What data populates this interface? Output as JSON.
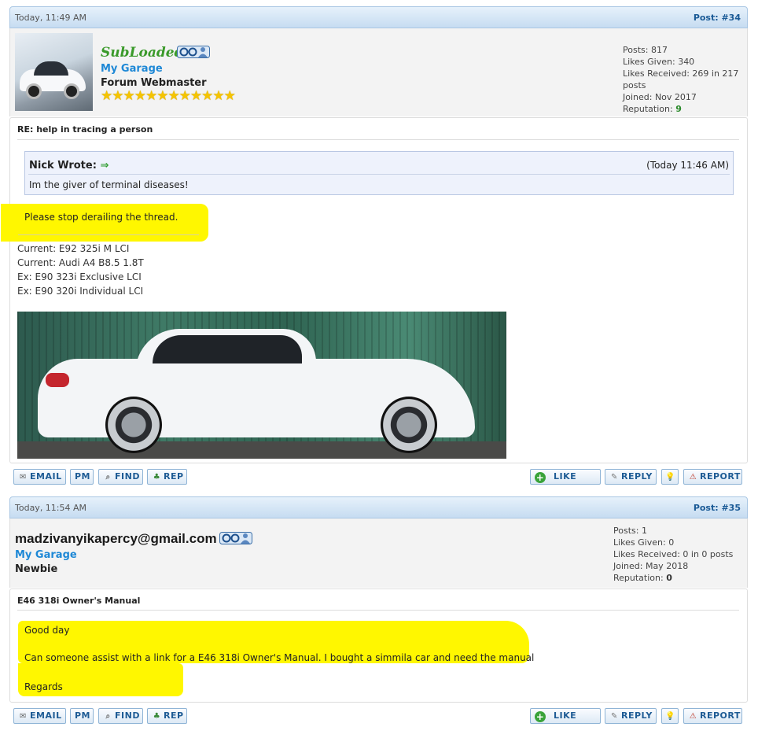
{
  "posts": [
    {
      "date": "Today, 11:49 AM",
      "post_no": "Post: #34",
      "username": "SubLoaded",
      "garage": "My Garage",
      "title": "Forum Webmaster",
      "stars": "★★★★★★★★★★★★",
      "stats": {
        "posts": "Posts: 817",
        "likes_given": "Likes Given: 340",
        "likes_received": "Likes Received: 269 in 217 posts",
        "joined": "Joined: Nov 2017",
        "reputation_label": "Reputation: ",
        "reputation_value": "9"
      },
      "subject": "RE: help in tracing a person",
      "quote": {
        "author": "Nick Wrote: ",
        "arrow": "⇒",
        "time": "(Today 11:46 AM)",
        "text": "Im the giver of terminal diseases!"
      },
      "body": "Please stop derailing the thread.",
      "signature": [
        "Current: E92 325i M LCI",
        "Current: Audi A4 B8.5 1.8T",
        "Ex: E90 323i Exclusive LCI",
        "Ex: E90 320i Individual LCI"
      ]
    },
    {
      "date": "Today, 11:54 AM",
      "post_no": "Post: #35",
      "username": "madzivanyikapercy@gmail.com",
      "garage": "My Garage",
      "title": "Newbie",
      "stats": {
        "posts": "Posts: 1",
        "likes_given": "Likes Given: 0",
        "likes_received": "Likes Received: 0 in 0 posts",
        "joined": "Joined: May 2018",
        "reputation_label": "Reputation: ",
        "reputation_value": "0"
      },
      "subject": "E46 318i Owner's Manual",
      "body": [
        "Good day",
        "Can someone assist with a link for a E46 318i Owner's Manual. I bought a simmila car and need the manual",
        "Regards"
      ]
    }
  ],
  "buttons": {
    "email": "EMAIL",
    "pm": "PM",
    "find": "FIND",
    "rep": "REP",
    "like": "LIKE",
    "reply": "REPLY",
    "report": "REPORT"
  },
  "colors": {
    "header_bg": "#c6dcf1",
    "username_green": "#3a9a2a",
    "garage_blue": "#1e88d6",
    "highlight": "#fff700",
    "button_text": "#1f5c95"
  }
}
